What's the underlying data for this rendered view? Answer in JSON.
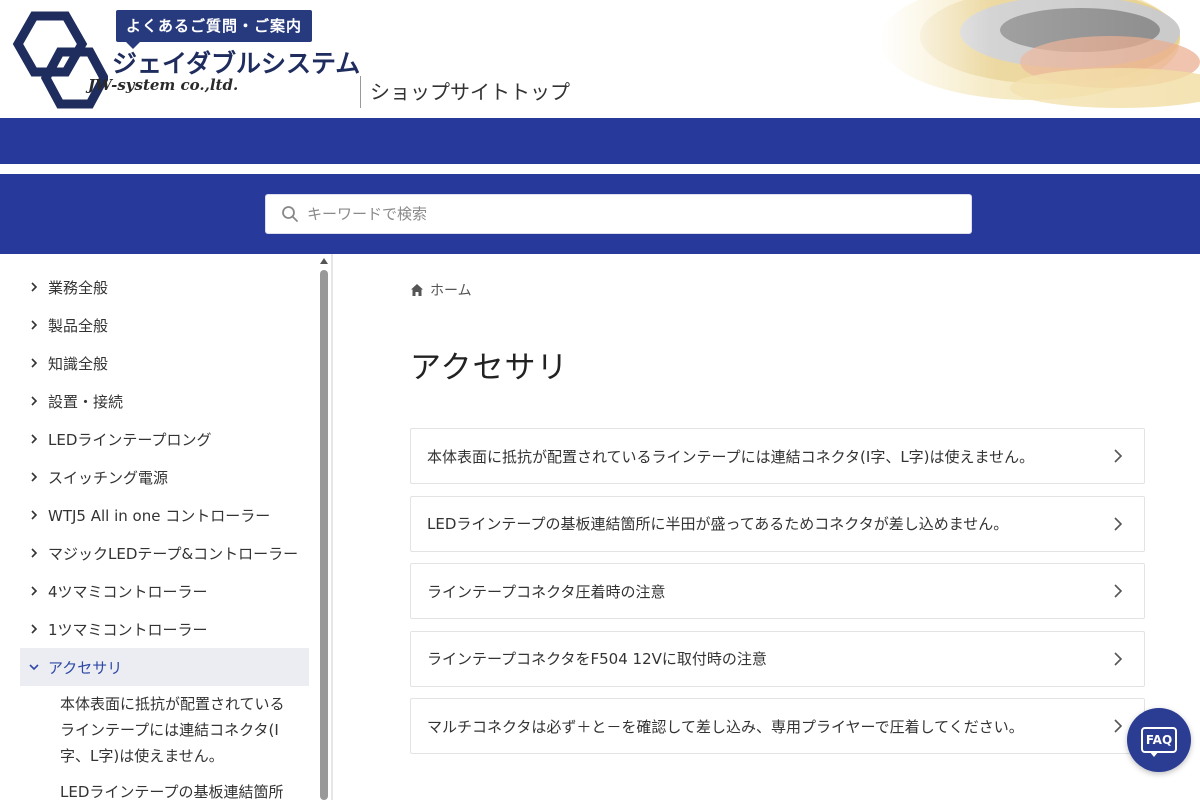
{
  "header": {
    "tagline": "よくあるご質問・ご案内",
    "company_ja": "ジェイダブルシステム",
    "company_en": "JW-system co.,ltd.",
    "shop_link": "ショップサイトトップ",
    "brand_color": "#273a9c"
  },
  "search": {
    "placeholder": "キーワードで検索",
    "icon": "search-icon"
  },
  "sidebar": {
    "items": [
      {
        "label": "業務全般"
      },
      {
        "label": "製品全般"
      },
      {
        "label": "知識全般"
      },
      {
        "label": "設置・接続"
      },
      {
        "label": "LEDラインテープロング"
      },
      {
        "label": "スイッチング電源"
      },
      {
        "label": "WTJ5 All in one コントローラー"
      },
      {
        "label": "マジックLEDテープ&コントローラー"
      },
      {
        "label": "4ツマミコントローラー"
      },
      {
        "label": "1ツマミコントローラー"
      },
      {
        "label": "アクセサリ",
        "expanded": true
      }
    ],
    "sub_items": [
      {
        "label": "本体表面に抵抗が配置されているラインテープには連結コネクタ(I字、L字)は使えません。"
      },
      {
        "label": "LEDラインテープの基板連結箇所に半"
      }
    ]
  },
  "breadcrumb": {
    "home": "ホーム"
  },
  "main": {
    "title": "アクセサリ",
    "articles": [
      {
        "label": "本体表面に抵抗が配置されているラインテープには連結コネクタ(I字、L字)は使えません。"
      },
      {
        "label": "LEDラインテープの基板連結箇所に半田が盛ってあるためコネクタが差し込めません。"
      },
      {
        "label": "ラインテープコネクタ圧着時の注意"
      },
      {
        "label": "ラインテープコネクタをF504 12Vに取付時の注意"
      },
      {
        "label": "マルチコネクタは必ず＋と－を確認して差し込み、専用プライヤーで圧着してください。"
      }
    ]
  },
  "faq_button": {
    "label": "FAQ"
  }
}
